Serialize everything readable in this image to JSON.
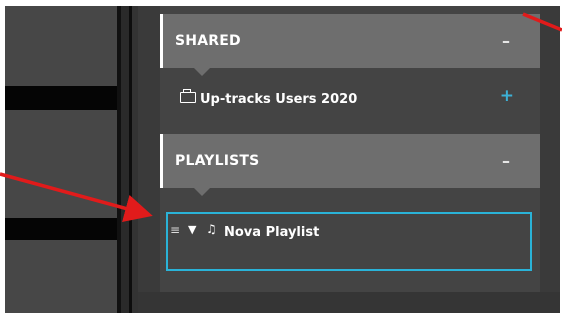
{
  "shared": {
    "title": "SHARED",
    "collapse_symbol": "–",
    "item_label": "Up-tracks Users 2020",
    "add_symbol": "+"
  },
  "playlists": {
    "title": "PLAYLISTS",
    "collapse_symbol": "–",
    "items": [
      {
        "handle": "≡",
        "expand": "▼",
        "icon": "♫",
        "label": "Nova Playlist"
      }
    ]
  },
  "colors": {
    "header_bg": "#6e6e6e",
    "selection_border": "#2ab3d8",
    "add_color": "#3db1d6",
    "annotation_arrow": "#e11b1b"
  }
}
